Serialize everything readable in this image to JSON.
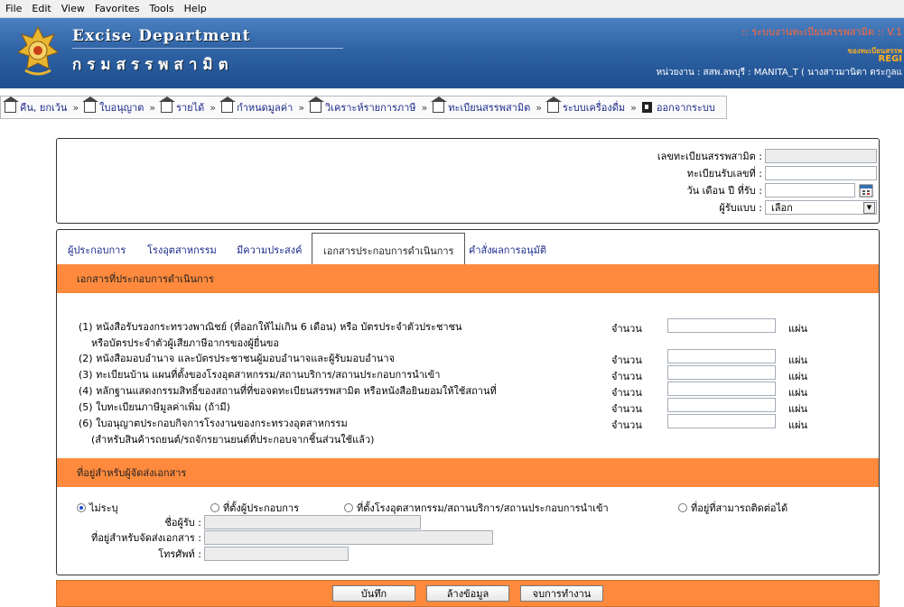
{
  "menubar": {
    "items": [
      "File",
      "Edit",
      "View",
      "Favorites",
      "Tools",
      "Help"
    ]
  },
  "header": {
    "brand_en": "Excise Department",
    "brand_th": "กรมสรรพสามิต",
    "system_title": ":: ระบบงานทะเบียนสรรพสามิต :: V.1",
    "system_sub": "ของทะเบียนสรรพ",
    "system_reg": "REGI",
    "unit_label": "หน่วยงาน",
    "unit_value": ": สสพ.ลพบุรี : MANITA_T ( นางสาวมานิตา ตระกูลแ"
  },
  "nav": {
    "items": [
      "คืน, ยกเว้น",
      "ใบอนุญาต",
      "รายได้",
      "กำหนดมูลค่า",
      "วิเคราะห์รายการภาษี",
      "ทะเบียนสรรพสามิต",
      "ระบบเครื่องดื่ม"
    ],
    "exit": "ออกจากระบบ",
    "separator": "»"
  },
  "top_form": {
    "reg_no_label": "เลขทะเบียนสรรพสามิต :",
    "receive_no_label": "ทะเบียนรับเลขที่ :",
    "receive_date_label": "วัน เดือน ปี ที่รับ :",
    "receiver_label": "ผู้รับแบบ :",
    "receiver_selected": "เลือก"
  },
  "tabs": [
    "ผู้ประกอบการ",
    "โรงอุตสาหกรรม",
    "มีความประสงค์",
    "เอกสารประกอบการดำเนินการ",
    "คำสั่งผลการอนุมัติ"
  ],
  "documents": {
    "header": "เอกสารที่ประกอบการดำเนินการ",
    "qty_label": "จำนวน",
    "unit": "แผ่น",
    "items": [
      {
        "line1": "(1) หนังสือรับรองกระทรวงพาณิชย์ (ที่ออกให้ไม่เกิน 6 เดือน) หรือ บัตรประจำตัวประชาชน",
        "line2": "หรือบัตรประจำตัวผู้เสียภาษีอากรของผู้ยื่นขอ"
      },
      {
        "line1": "(2) หนังสือมอบอำนาจ และบัตรประชาชนผู้มอบอำนาจและผู้รับมอบอำนาจ",
        "line2": ""
      },
      {
        "line1": "(3) ทะเบียนบ้าน แผนที่ตั้งของโรงอุตสาหกรรม/สถานบริการ/สถานประกอบการนำเข้า",
        "line2": ""
      },
      {
        "line1": "(4) หลักฐานแสดงกรรมสิทธิ์ของสถานที่ที่ขอจดทะเบียนสรรพสามิต หรือหนังสือยินยอมให้ใช้สถานที่",
        "line2": ""
      },
      {
        "line1": "(5) ใบทะเบียนภาษีมูลค่าเพิ่ม (ถ้ามี)",
        "line2": ""
      },
      {
        "line1": "(6) ใบอนุญาตประกอบกิจการโรงงานของกระทรวงอุตสาหกรรม",
        "line2": "(สำหรับสินค้ารถยนต์/รถจักรยานยนต์ที่ประกอบจากชิ้นส่วนใช้แล้ว)"
      }
    ]
  },
  "address": {
    "header": "ที่อยู่สำหรับผู้จัดส่งเอกสาร",
    "options": [
      "ไม่ระบุ",
      "ที่ตั้งผู้ประกอบการ",
      "ที่ตั้งโรงอุตสาหกรรม/สถานบริการ/สถานประกอบการนำเข้า",
      "ที่อยู่ที่สามารถติดต่อได้"
    ],
    "selected_index": 0,
    "recipient_label": "ชื่อผู้รับ :",
    "address_label": "ที่อยู่สำหรับจัดส่งเอกสาร :",
    "phone_label": "โทรศัพท์ :"
  },
  "buttons": {
    "save": "บันทึก",
    "clear": "ล้างข้อมูล",
    "finish": "จบการทำงาน"
  },
  "colors": {
    "banner": "#2f63a5",
    "section": "#ff8a3d",
    "link": "#1b2a8a"
  }
}
